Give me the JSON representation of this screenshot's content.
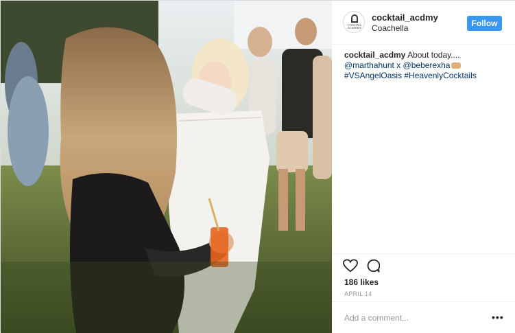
{
  "post": {
    "username": "cocktail_acdmy",
    "location": "Coachella",
    "follow_label": "Follow",
    "avatar_text": "COCKTAIL ACADEMY",
    "caption": {
      "username": "cocktail_acdmy",
      "text": "About today....",
      "mentions": "@marthahunt x @beberexha",
      "hashtags": "#VSAngelOasis #HeavenlyCocktails"
    },
    "likes": "186 likes",
    "date": "APRIL 14",
    "comment_placeholder": "Add a comment...",
    "more_label": "•••"
  },
  "icons": {
    "like": "heart-icon",
    "comment": "comment-bubble-icon",
    "more": "more-options-icon"
  },
  "colors": {
    "follow_button": "#3897f0",
    "link": "#003569",
    "text": "#262626",
    "muted": "#999999"
  }
}
